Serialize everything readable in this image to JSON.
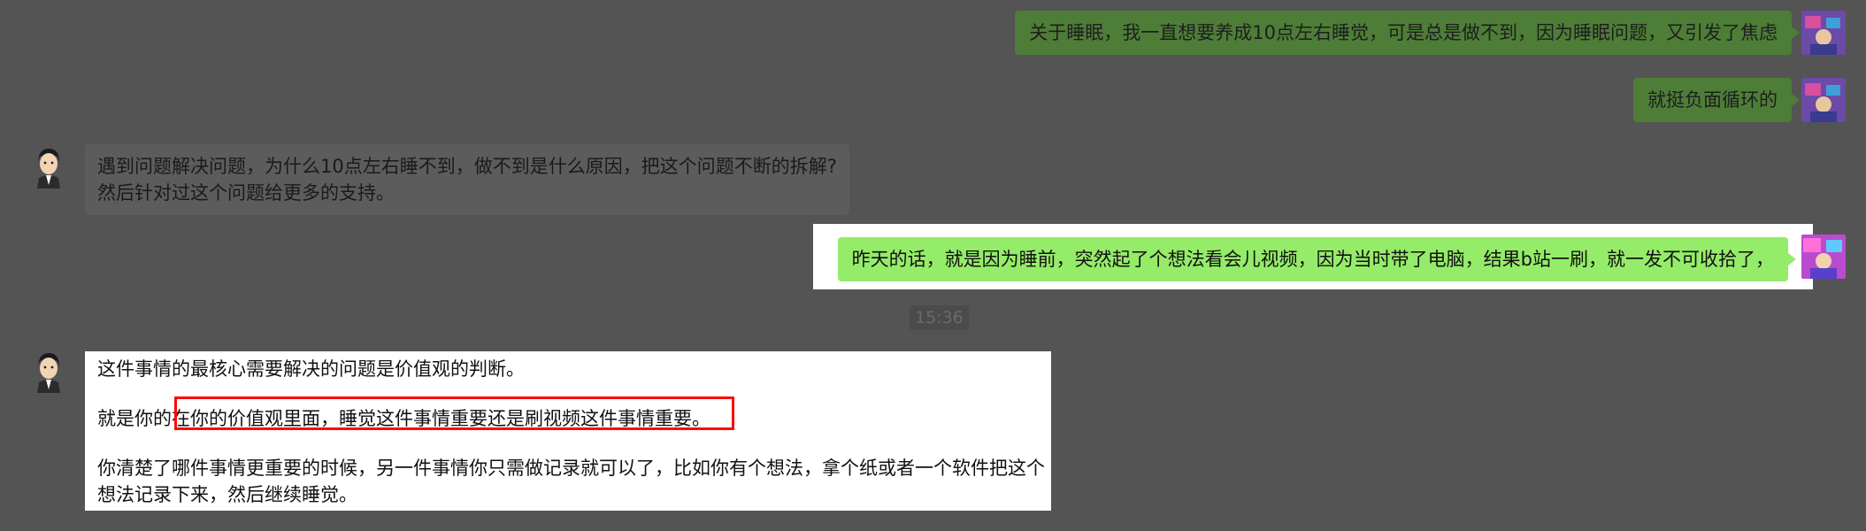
{
  "messages": [
    {
      "sender": "self",
      "text": "关于睡眠，我一直想要养成10点左右睡觉，可是总是做不到，因为睡眠问题，又引发了焦虑"
    },
    {
      "sender": "self",
      "text": "就挺负面循环的"
    },
    {
      "sender": "other",
      "lines": [
        "遇到问题解决问题，为什么10点左右睡不到，做不到是什么原因，把这个问题不断的拆解?",
        "然后针对过这个问题给更多的支持。"
      ]
    },
    {
      "sender": "self",
      "text": "昨天的话，就是因为睡前，突然起了个想法看会儿视频，因为当时带了电脑，结果b站一刷，就一发不可收拾了，",
      "highlighted": true
    },
    {
      "sender": "other",
      "highlighted": true,
      "paragraphs": [
        "这件事情的最核心需要解决的问题是价值观的判断。",
        "就是你的在你的价值观里面，睡觉这件事情重要还是刷视频这件事情重要。",
        "你清楚了哪件事情更重要的时候，另一件事情你只需做记录就可以了，比如你有个想法，拿个纸或者一个软件把这个",
        "想法记录下来，然后继续睡觉。"
      ]
    }
  ],
  "timestamp": "15:36",
  "annotation": {
    "color": "#ff0a0a",
    "marked_text": "在你的价值观里面，睡觉这件事情重要还是刷视频这件事情重要。"
  },
  "colors": {
    "background": "#545454",
    "self_bubble": "#4d7d37",
    "self_bubble_highlight": "#95ec69",
    "other_bubble": "#5c5c5c"
  },
  "icons": {
    "self_avatar": "user-avatar-icon",
    "other_avatar": "counselor-avatar-icon"
  }
}
